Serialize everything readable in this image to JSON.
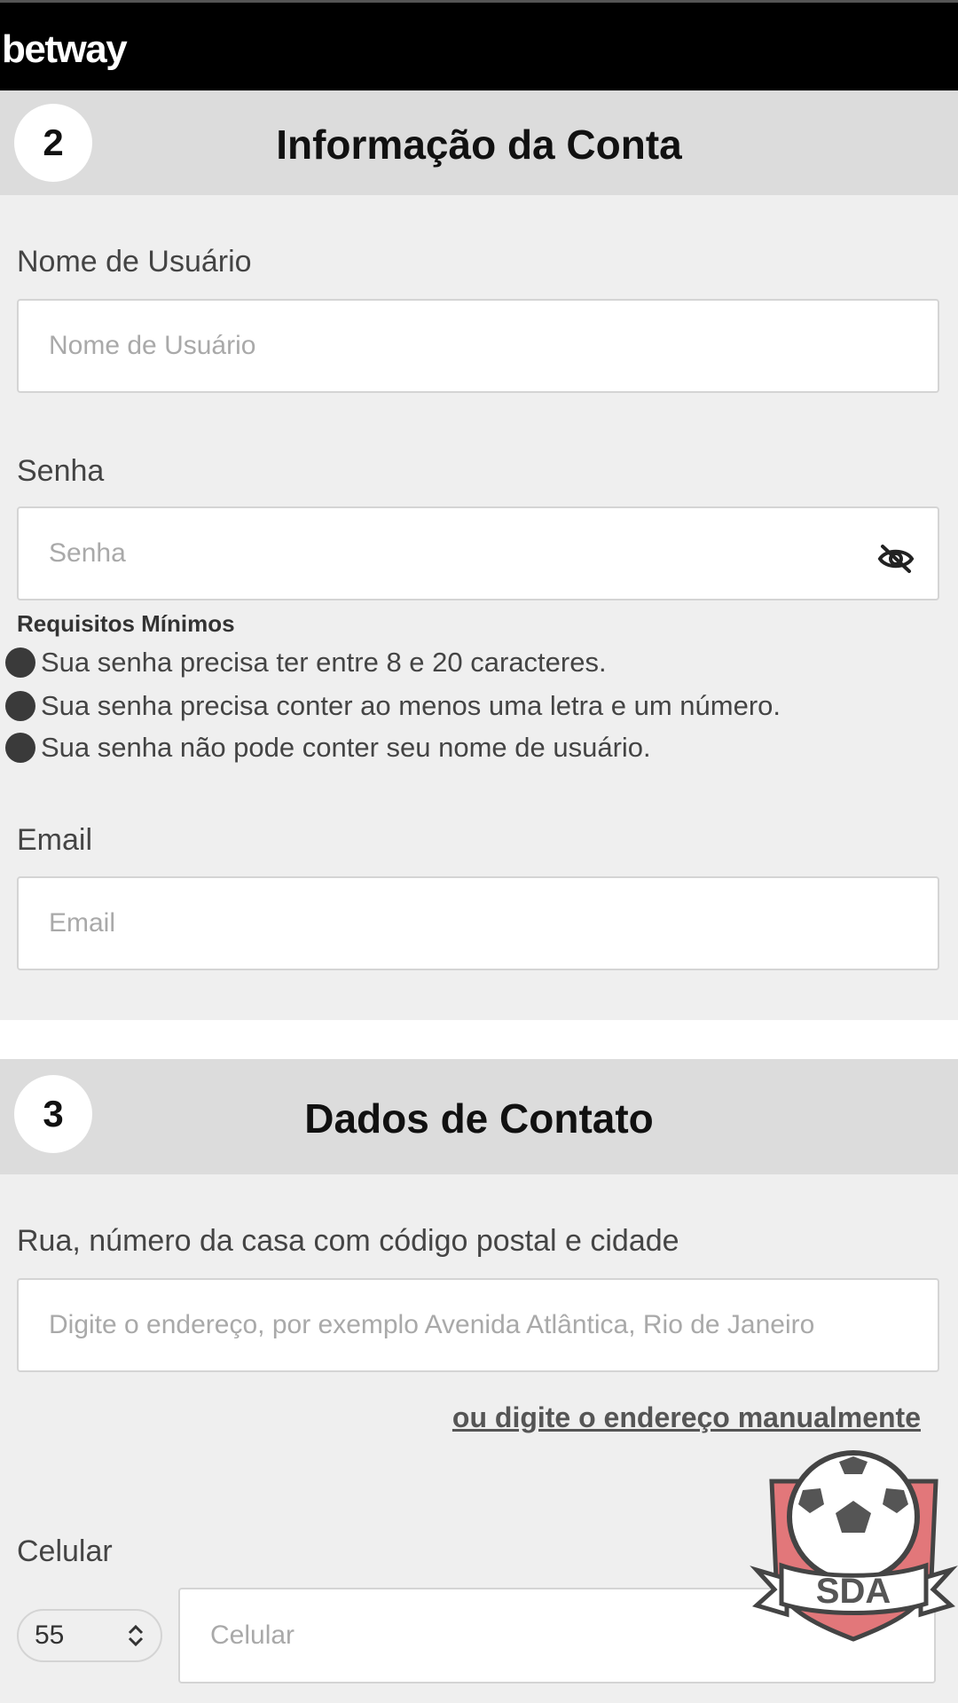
{
  "header": {
    "logo": "betway"
  },
  "account_section": {
    "step": "2",
    "title": "Informação da Conta",
    "username": {
      "label": "Nome de Usuário",
      "placeholder": "Nome de Usuário"
    },
    "password": {
      "label": "Senha",
      "placeholder": "Senha",
      "toggle_icon": "eye-slash-icon"
    },
    "requirements": {
      "title": "Requisitos Mínimos",
      "items": [
        "Sua senha precisa ter entre 8 e 20 caracteres.",
        "Sua senha precisa conter ao menos uma letra e um número.",
        "Sua senha não pode conter seu nome de usuário."
      ]
    },
    "email": {
      "label": "Email",
      "placeholder": "Email"
    }
  },
  "contact_section": {
    "step": "3",
    "title": "Dados de Contato",
    "address": {
      "label": "Rua, número da casa com código postal e cidade",
      "placeholder": "Digite o endereço, por exemplo Avenida Atlântica, Rio de Janeiro"
    },
    "manual_link": "ou digite o endereço manualmente",
    "phone": {
      "label": "Celular",
      "country_code": "55",
      "placeholder": "Celular"
    }
  },
  "watermark": {
    "text": "SDA"
  },
  "colors": {
    "topbar": "#000000",
    "section_header": "#dcdcdc",
    "page_background": "#efefef",
    "watermark_red": "#e2777a"
  }
}
